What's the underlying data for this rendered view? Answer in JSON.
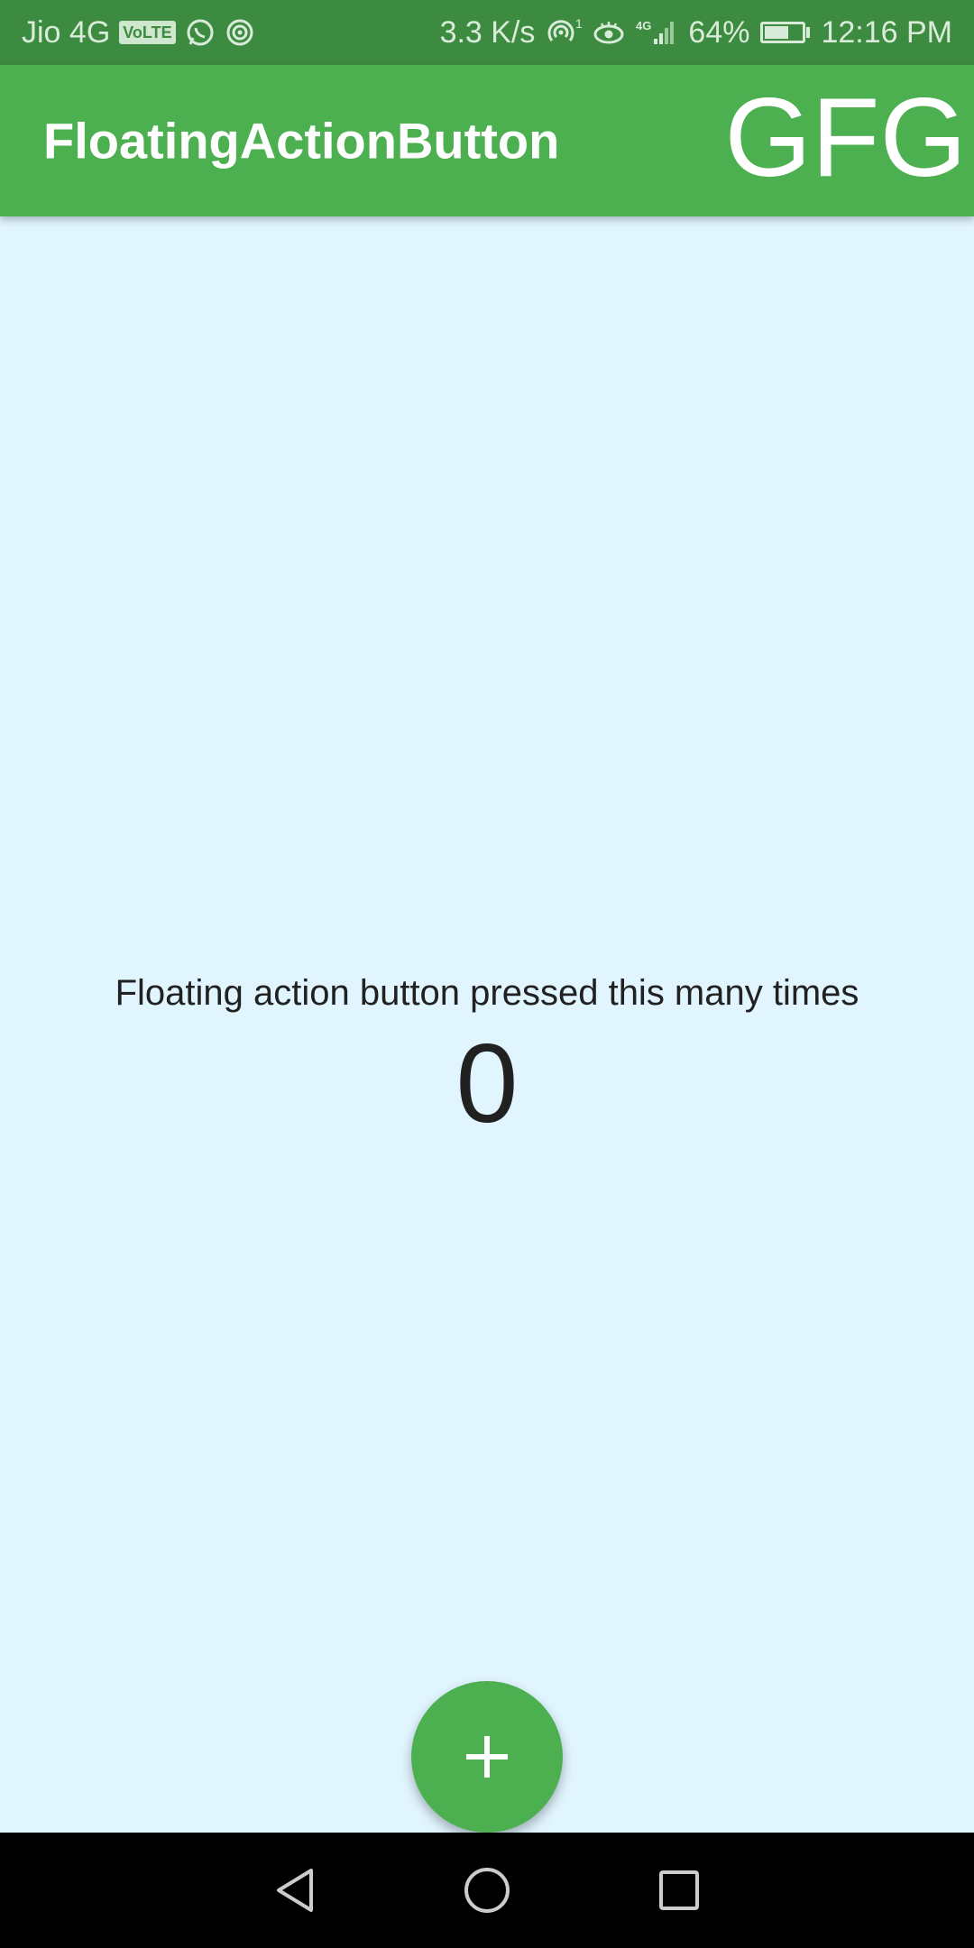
{
  "status_bar": {
    "carrier": "Jio 4G",
    "volte": "VoLTE",
    "speed": "3.3 K/s",
    "hotspot_count": "1",
    "network": "4G",
    "battery": "64%",
    "battery_level": 0.64,
    "time": "12:16 PM",
    "icons": [
      "whatsapp-icon",
      "hotspot-icon",
      "wifi-hotspot-icon",
      "eye-icon",
      "signal-icon",
      "battery-icon"
    ]
  },
  "app_bar": {
    "title": "FloatingActionButton",
    "action": "GFG",
    "color": "#4caf50"
  },
  "main": {
    "message": "Floating action button pressed this many times",
    "counter": "0",
    "background": "#e1f5fe"
  },
  "fab": {
    "icon": "plus-icon",
    "label": "+",
    "color": "#4caf50"
  },
  "nav_bar": {
    "buttons": [
      "back-icon",
      "home-icon",
      "recents-icon"
    ]
  }
}
